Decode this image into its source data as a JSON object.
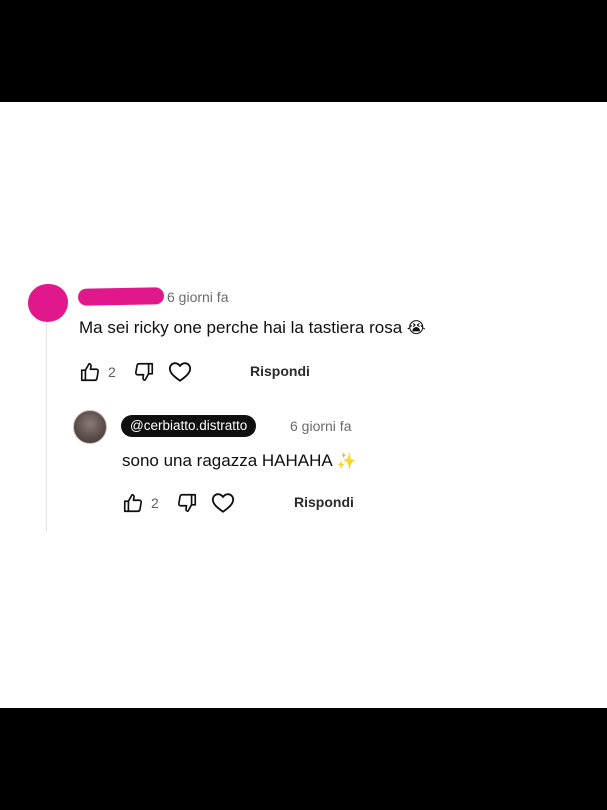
{
  "comment": {
    "timestamp": "6 giorni fa",
    "text": "Ma sei ricky one perche hai la tastiera rosa",
    "emoji": "😭",
    "likes": "2",
    "reply_label": "Rispondi",
    "icons": [
      "thumbs-up-icon",
      "thumbs-down-icon",
      "heart-icon"
    ],
    "author_color": "#e0188b"
  },
  "reply": {
    "handle": "@cerbiatto.distratto",
    "timestamp": "6 giorni fa",
    "text": "sono una ragazza HAHAHA",
    "emoji": "✨",
    "likes": "2",
    "reply_label": "Rispondi"
  }
}
